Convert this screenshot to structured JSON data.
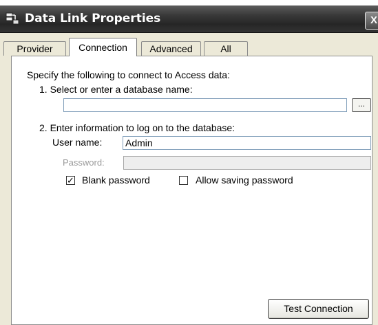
{
  "window": {
    "title": "Data Link Properties",
    "close_glyph": "X",
    "icon": "data-link-icon"
  },
  "tabs": [
    {
      "label": "Provider",
      "active": false
    },
    {
      "label": "Connection",
      "active": true
    },
    {
      "label": "Advanced",
      "active": false
    },
    {
      "label": "All",
      "active": false
    }
  ],
  "connection": {
    "intro": "Specify the following to connect to Access data:",
    "step1_label": "1. Select or enter a database name:",
    "database_name_value": "",
    "browse_label": "...",
    "step2_label": "2. Enter information to log on to the database:",
    "username_label": "User name:",
    "username_value": "Admin",
    "password_label": "Password:",
    "password_value": "",
    "blank_password_label": "Blank password",
    "blank_password_checked": true,
    "allow_saving_label": "Allow saving password",
    "allow_saving_checked": false,
    "test_connection_label": "Test Connection"
  }
}
